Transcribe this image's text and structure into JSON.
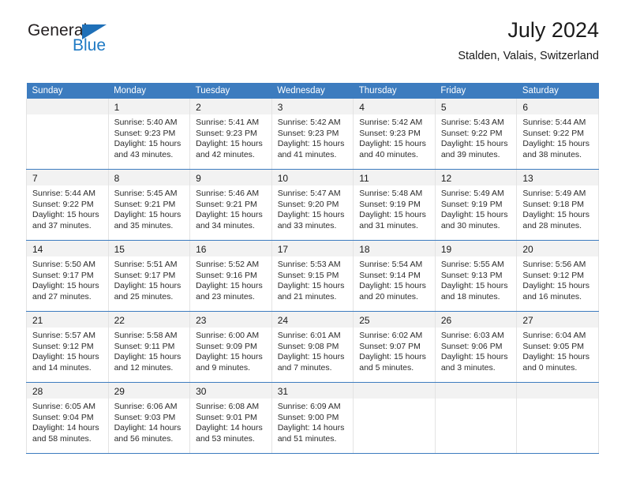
{
  "brand": {
    "name_part1": "General",
    "name_part2": "Blue",
    "accent_color": "#1f70b8"
  },
  "header": {
    "title": "July 2024",
    "subtitle": "Stalden, Valais, Switzerland"
  },
  "calendar": {
    "header_color": "#3d7cbf",
    "weekdays": [
      "Sunday",
      "Monday",
      "Tuesday",
      "Wednesday",
      "Thursday",
      "Friday",
      "Saturday"
    ],
    "weeks": [
      [
        {
          "day": "",
          "sunrise": "",
          "sunset": "",
          "daylight_line1": "",
          "daylight_line2": ""
        },
        {
          "day": "1",
          "sunrise": "Sunrise: 5:40 AM",
          "sunset": "Sunset: 9:23 PM",
          "daylight_line1": "Daylight: 15 hours",
          "daylight_line2": "and 43 minutes."
        },
        {
          "day": "2",
          "sunrise": "Sunrise: 5:41 AM",
          "sunset": "Sunset: 9:23 PM",
          "daylight_line1": "Daylight: 15 hours",
          "daylight_line2": "and 42 minutes."
        },
        {
          "day": "3",
          "sunrise": "Sunrise: 5:42 AM",
          "sunset": "Sunset: 9:23 PM",
          "daylight_line1": "Daylight: 15 hours",
          "daylight_line2": "and 41 minutes."
        },
        {
          "day": "4",
          "sunrise": "Sunrise: 5:42 AM",
          "sunset": "Sunset: 9:23 PM",
          "daylight_line1": "Daylight: 15 hours",
          "daylight_line2": "and 40 minutes."
        },
        {
          "day": "5",
          "sunrise": "Sunrise: 5:43 AM",
          "sunset": "Sunset: 9:22 PM",
          "daylight_line1": "Daylight: 15 hours",
          "daylight_line2": "and 39 minutes."
        },
        {
          "day": "6",
          "sunrise": "Sunrise: 5:44 AM",
          "sunset": "Sunset: 9:22 PM",
          "daylight_line1": "Daylight: 15 hours",
          "daylight_line2": "and 38 minutes."
        }
      ],
      [
        {
          "day": "7",
          "sunrise": "Sunrise: 5:44 AM",
          "sunset": "Sunset: 9:22 PM",
          "daylight_line1": "Daylight: 15 hours",
          "daylight_line2": "and 37 minutes."
        },
        {
          "day": "8",
          "sunrise": "Sunrise: 5:45 AM",
          "sunset": "Sunset: 9:21 PM",
          "daylight_line1": "Daylight: 15 hours",
          "daylight_line2": "and 35 minutes."
        },
        {
          "day": "9",
          "sunrise": "Sunrise: 5:46 AM",
          "sunset": "Sunset: 9:21 PM",
          "daylight_line1": "Daylight: 15 hours",
          "daylight_line2": "and 34 minutes."
        },
        {
          "day": "10",
          "sunrise": "Sunrise: 5:47 AM",
          "sunset": "Sunset: 9:20 PM",
          "daylight_line1": "Daylight: 15 hours",
          "daylight_line2": "and 33 minutes."
        },
        {
          "day": "11",
          "sunrise": "Sunrise: 5:48 AM",
          "sunset": "Sunset: 9:19 PM",
          "daylight_line1": "Daylight: 15 hours",
          "daylight_line2": "and 31 minutes."
        },
        {
          "day": "12",
          "sunrise": "Sunrise: 5:49 AM",
          "sunset": "Sunset: 9:19 PM",
          "daylight_line1": "Daylight: 15 hours",
          "daylight_line2": "and 30 minutes."
        },
        {
          "day": "13",
          "sunrise": "Sunrise: 5:49 AM",
          "sunset": "Sunset: 9:18 PM",
          "daylight_line1": "Daylight: 15 hours",
          "daylight_line2": "and 28 minutes."
        }
      ],
      [
        {
          "day": "14",
          "sunrise": "Sunrise: 5:50 AM",
          "sunset": "Sunset: 9:17 PM",
          "daylight_line1": "Daylight: 15 hours",
          "daylight_line2": "and 27 minutes."
        },
        {
          "day": "15",
          "sunrise": "Sunrise: 5:51 AM",
          "sunset": "Sunset: 9:17 PM",
          "daylight_line1": "Daylight: 15 hours",
          "daylight_line2": "and 25 minutes."
        },
        {
          "day": "16",
          "sunrise": "Sunrise: 5:52 AM",
          "sunset": "Sunset: 9:16 PM",
          "daylight_line1": "Daylight: 15 hours",
          "daylight_line2": "and 23 minutes."
        },
        {
          "day": "17",
          "sunrise": "Sunrise: 5:53 AM",
          "sunset": "Sunset: 9:15 PM",
          "daylight_line1": "Daylight: 15 hours",
          "daylight_line2": "and 21 minutes."
        },
        {
          "day": "18",
          "sunrise": "Sunrise: 5:54 AM",
          "sunset": "Sunset: 9:14 PM",
          "daylight_line1": "Daylight: 15 hours",
          "daylight_line2": "and 20 minutes."
        },
        {
          "day": "19",
          "sunrise": "Sunrise: 5:55 AM",
          "sunset": "Sunset: 9:13 PM",
          "daylight_line1": "Daylight: 15 hours",
          "daylight_line2": "and 18 minutes."
        },
        {
          "day": "20",
          "sunrise": "Sunrise: 5:56 AM",
          "sunset": "Sunset: 9:12 PM",
          "daylight_line1": "Daylight: 15 hours",
          "daylight_line2": "and 16 minutes."
        }
      ],
      [
        {
          "day": "21",
          "sunrise": "Sunrise: 5:57 AM",
          "sunset": "Sunset: 9:12 PM",
          "daylight_line1": "Daylight: 15 hours",
          "daylight_line2": "and 14 minutes."
        },
        {
          "day": "22",
          "sunrise": "Sunrise: 5:58 AM",
          "sunset": "Sunset: 9:11 PM",
          "daylight_line1": "Daylight: 15 hours",
          "daylight_line2": "and 12 minutes."
        },
        {
          "day": "23",
          "sunrise": "Sunrise: 6:00 AM",
          "sunset": "Sunset: 9:09 PM",
          "daylight_line1": "Daylight: 15 hours",
          "daylight_line2": "and 9 minutes."
        },
        {
          "day": "24",
          "sunrise": "Sunrise: 6:01 AM",
          "sunset": "Sunset: 9:08 PM",
          "daylight_line1": "Daylight: 15 hours",
          "daylight_line2": "and 7 minutes."
        },
        {
          "day": "25",
          "sunrise": "Sunrise: 6:02 AM",
          "sunset": "Sunset: 9:07 PM",
          "daylight_line1": "Daylight: 15 hours",
          "daylight_line2": "and 5 minutes."
        },
        {
          "day": "26",
          "sunrise": "Sunrise: 6:03 AM",
          "sunset": "Sunset: 9:06 PM",
          "daylight_line1": "Daylight: 15 hours",
          "daylight_line2": "and 3 minutes."
        },
        {
          "day": "27",
          "sunrise": "Sunrise: 6:04 AM",
          "sunset": "Sunset: 9:05 PM",
          "daylight_line1": "Daylight: 15 hours",
          "daylight_line2": "and 0 minutes."
        }
      ],
      [
        {
          "day": "28",
          "sunrise": "Sunrise: 6:05 AM",
          "sunset": "Sunset: 9:04 PM",
          "daylight_line1": "Daylight: 14 hours",
          "daylight_line2": "and 58 minutes."
        },
        {
          "day": "29",
          "sunrise": "Sunrise: 6:06 AM",
          "sunset": "Sunset: 9:03 PM",
          "daylight_line1": "Daylight: 14 hours",
          "daylight_line2": "and 56 minutes."
        },
        {
          "day": "30",
          "sunrise": "Sunrise: 6:08 AM",
          "sunset": "Sunset: 9:01 PM",
          "daylight_line1": "Daylight: 14 hours",
          "daylight_line2": "and 53 minutes."
        },
        {
          "day": "31",
          "sunrise": "Sunrise: 6:09 AM",
          "sunset": "Sunset: 9:00 PM",
          "daylight_line1": "Daylight: 14 hours",
          "daylight_line2": "and 51 minutes."
        },
        {
          "day": "",
          "sunrise": "",
          "sunset": "",
          "daylight_line1": "",
          "daylight_line2": ""
        },
        {
          "day": "",
          "sunrise": "",
          "sunset": "",
          "daylight_line1": "",
          "daylight_line2": ""
        },
        {
          "day": "",
          "sunrise": "",
          "sunset": "",
          "daylight_line1": "",
          "daylight_line2": ""
        }
      ]
    ]
  }
}
